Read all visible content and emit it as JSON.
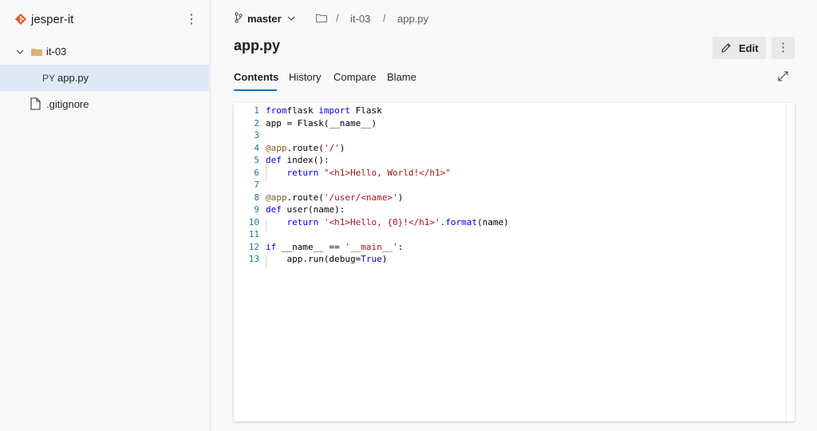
{
  "repo": {
    "name": "jesper-it",
    "more": "⋮"
  },
  "tree": [
    {
      "type": "folder",
      "label": "it-03",
      "expanded": true
    },
    {
      "type": "file",
      "badge": "PY",
      "label": "app.py",
      "selected": true
    },
    {
      "type": "file",
      "label": ".gitignore"
    }
  ],
  "branch": {
    "label": "master"
  },
  "breadcrumb": {
    "sep": "/",
    "items": [
      "it-03",
      "app.py"
    ]
  },
  "file": {
    "title": "app.py"
  },
  "toolbar": {
    "edit_label": "Edit",
    "more": "⋮"
  },
  "tabs": [
    "Contents",
    "History",
    "Compare",
    "Blame"
  ],
  "code": {
    "line_numbers": [
      "1",
      "2",
      "3",
      "4",
      "5",
      "6",
      "7",
      "8",
      "9",
      "10",
      "11",
      "12",
      "13"
    ],
    "lines": [
      [
        [
          "kw",
          "from"
        ],
        [
          "",
          "flask "
        ],
        [
          "kw",
          "import"
        ],
        [
          "",
          " Flask"
        ]
      ],
      [
        [
          "",
          "app = Flask(__name__)"
        ]
      ],
      [],
      [
        [
          "dec",
          "@app"
        ],
        [
          "",
          ".route("
        ],
        [
          "str",
          "'/'"
        ],
        [
          "",
          ")"
        ]
      ],
      [
        [
          "kw",
          "def"
        ],
        [
          "",
          " index():"
        ]
      ],
      [
        [
          "",
          "    "
        ],
        [
          "kw",
          "return"
        ],
        [
          "",
          " "
        ],
        [
          "str",
          "\"<h1>Hello, World!</h1>\""
        ]
      ],
      [],
      [
        [
          "dec",
          "@app"
        ],
        [
          "",
          ".route("
        ],
        [
          "str",
          "'/user/<name>'"
        ],
        [
          "",
          ")"
        ]
      ],
      [
        [
          "kw",
          "def"
        ],
        [
          "",
          " user(name):"
        ]
      ],
      [
        [
          "",
          "    "
        ],
        [
          "kw",
          "return"
        ],
        [
          "",
          " "
        ],
        [
          "str",
          "'<h1>Hello, {0}!</h1>'"
        ],
        [
          "",
          "."
        ],
        [
          "kw",
          "format"
        ],
        [
          "",
          "(name)"
        ]
      ],
      [],
      [
        [
          "kw",
          "if"
        ],
        [
          "",
          " __name__ == "
        ],
        [
          "str",
          "'__main__'"
        ],
        [
          "",
          ":"
        ]
      ],
      [
        [
          "",
          "    app.run(debug="
        ],
        [
          "kw",
          "True"
        ],
        [
          "",
          ")"
        ]
      ]
    ]
  },
  "colors": {
    "accent": "#0078d4",
    "keyword": "#0000ff",
    "string": "#a31515",
    "selected_bg": "#dfe9f6",
    "repo_icon": "#e05d2e"
  }
}
